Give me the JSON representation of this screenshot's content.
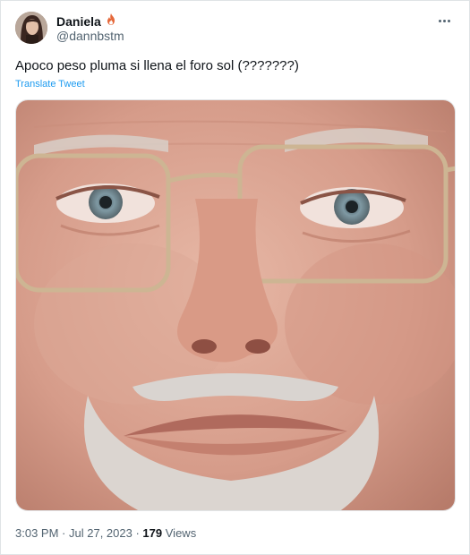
{
  "user": {
    "display_name": "Daniela",
    "handle": "@dannbstm",
    "name_emoji": "fire-icon"
  },
  "tweet": {
    "text": "Apoco peso pluma si llena el foro sol (???????)",
    "translate_label": "Translate Tweet",
    "time": "3:03 PM",
    "date": "Jul 27, 2023",
    "views_count": "179",
    "views_label": "Views"
  },
  "icons": {
    "more": "more-horizontal-icon"
  },
  "colors": {
    "accent": "#1d9bf0",
    "text": "#0f1419",
    "secondary": "#536471"
  }
}
